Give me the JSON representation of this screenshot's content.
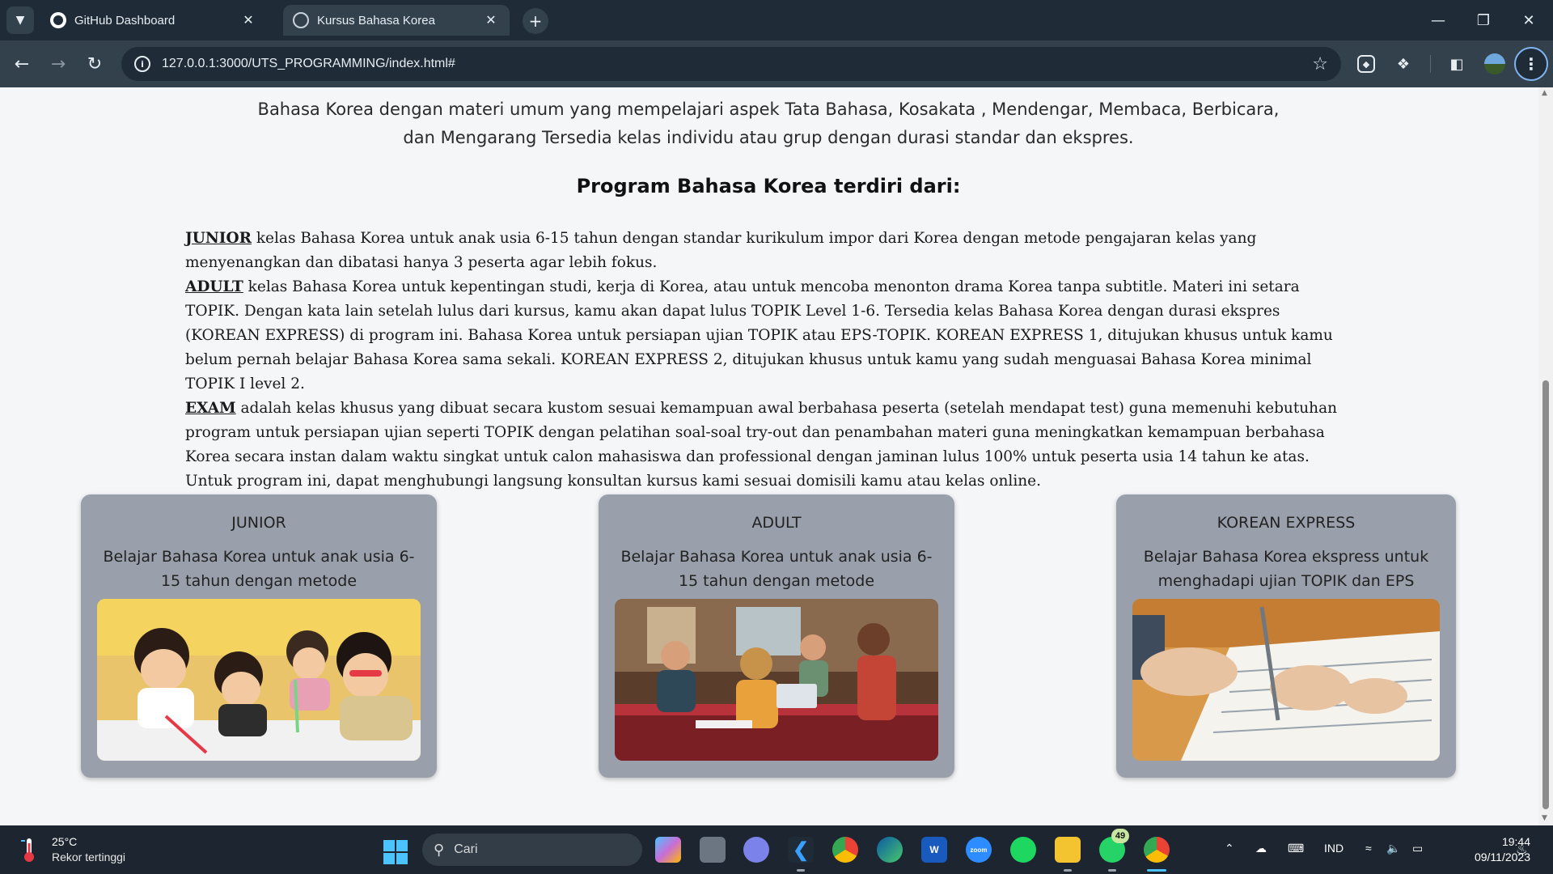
{
  "browser": {
    "tabs": [
      {
        "title": "GitHub Dashboard",
        "active": false
      },
      {
        "title": "Kursus Bahasa Korea",
        "active": true
      }
    ],
    "url": "127.0.0.1:3000/UTS_PROGRAMMING/index.html#"
  },
  "page": {
    "intro": "Bahasa Korea dengan materi umum yang mempelajari aspek Tata Bahasa, Kosakata , Mendengar, Membaca, Berbicara, dan Mengarang Tersedia kelas individu atau grup dengan durasi standar dan ekspres.",
    "program_title": "Program Bahasa Korea terdiri dari:",
    "programs": [
      {
        "keyword": "JUNIOR",
        "text": " kelas Bahasa Korea untuk anak usia 6-15 tahun dengan standar kurikulum impor dari Korea dengan metode pengajaran kelas yang menyenangkan dan dibatasi hanya 3 peserta agar lebih fokus."
      },
      {
        "keyword": "ADULT",
        "text": " kelas Bahasa Korea untuk kepentingan studi, kerja di Korea, atau untuk mencoba menonton drama Korea tanpa subtitle. Materi ini setara TOPIK. Dengan kata lain setelah lulus dari kursus, kamu akan dapat lulus TOPIK Level 1-6. Tersedia kelas Bahasa Korea dengan durasi ekspres (KOREAN EXPRESS) di program ini. Bahasa Korea untuk persiapan ujian TOPIK atau EPS-TOPIK. KOREAN EXPRESS 1, ditujukan khusus untuk kamu belum pernah belajar Bahasa Korea sama sekali. KOREAN EXPRESS 2, ditujukan khusus untuk kamu yang sudah menguasai Bahasa Korea minimal TOPIK I level 2."
      },
      {
        "keyword": "EXAM",
        "text": " adalah kelas khusus yang dibuat secara kustom sesuai kemampuan awal berbahasa peserta (setelah mendapat test) guna memenuhi kebutuhan program untuk persiapan ujian seperti TOPIK dengan pelatihan soal-soal try-out dan penambahan materi guna meningkatkan kemampuan berbahasa Korea secara instan dalam waktu singkat untuk calon mahasiswa dan professional dengan jaminan lulus 100% untuk peserta usia 14 tahun ke atas. Untuk program ini, dapat menghubungi langsung konsultan kursus kami sesuai domisili kamu atau kelas online."
      }
    ],
    "cards": [
      {
        "title": "JUNIOR",
        "desc": "Belajar Bahasa Korea untuk anak usia 6-15 tahun dengan metode menyenangkan."
      },
      {
        "title": "ADULT",
        "desc": "Belajar Bahasa Korea untuk anak usia 6-15 tahun dengan metode menyenangkan."
      },
      {
        "title": "KOREAN EXPRESS",
        "desc": "Belajar Bahasa Korea ekspress untuk menghadapi ujian TOPIK dan EPS TOPIK."
      }
    ]
  },
  "taskbar": {
    "weather_temp": "25°C",
    "weather_desc": "Rekor tertinggi",
    "search_placeholder": "Cari",
    "whatsapp_badge": "49",
    "language": "IND",
    "time": "19:44",
    "date": "09/11/2023",
    "apps": [
      "copilot-icon",
      "task-view-icon",
      "chat-icon",
      "vscode-icon",
      "chrome-icon",
      "edge-icon",
      "word-icon",
      "zoom-icon",
      "spotify-icon",
      "file-explorer-icon",
      "whatsapp-icon",
      "chrome-profile-icon"
    ]
  },
  "colors": {
    "card_bg": "#9aa0ab",
    "page_bg": "#f5f6f8",
    "chrome_dark": "#1f2b36",
    "taskbar_bg": "#1c2530"
  }
}
